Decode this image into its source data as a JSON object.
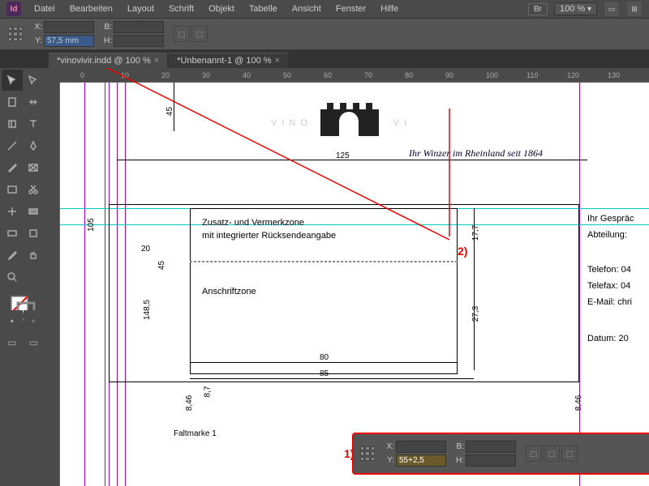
{
  "menu": {
    "items": [
      "Datei",
      "Bearbeiten",
      "Layout",
      "Schrift",
      "Objekt",
      "Tabelle",
      "Ansicht",
      "Fenster",
      "Hilfe"
    ],
    "br": "Br",
    "zoom": "100 %"
  },
  "ctrl": {
    "x": "",
    "y": "57,5 mm",
    "b": "",
    "h": ""
  },
  "tabs": [
    {
      "label": "*vinovivir.indd @ 100 %",
      "active": true
    },
    {
      "label": "*Unbenannt-1 @ 100 %",
      "active": false
    }
  ],
  "ruler_ticks": [
    "0",
    "10",
    "20",
    "30",
    "40",
    "50",
    "60",
    "70",
    "80",
    "90",
    "100",
    "110",
    "120",
    "130"
  ],
  "doc": {
    "brand": "VINO",
    "brand2": "VI",
    "tagline": "Ihr Winzer im Rheinland seit 1864",
    "zone1a": "Zusatz- und Vermerkzone",
    "zone1b": "mit integrierter Rücksendeangabe",
    "zone2": "Anschriftzone",
    "right": [
      "Ihr Gespräc",
      "Abteilung:",
      "Telefon: 04",
      "Telefax: 04",
      "E-Mail: chri",
      "Datum: 20"
    ],
    "dims": {
      "d45a": "45",
      "d125": "125",
      "d105": "105",
      "d20": "20",
      "d45b": "45",
      "d1485": "148,5",
      "d177": "17,7",
      "d273": "27,3",
      "d80": "80",
      "d85": "85",
      "d846a": "8,46",
      "d846b": "8,46",
      "d87": "8,7"
    },
    "faltmarke": "Faltmarke 1"
  },
  "annot": {
    "a1": "1)",
    "a2": "2)"
  },
  "float": {
    "x": "",
    "y": "55+2,5",
    "b": "",
    "h": ""
  }
}
